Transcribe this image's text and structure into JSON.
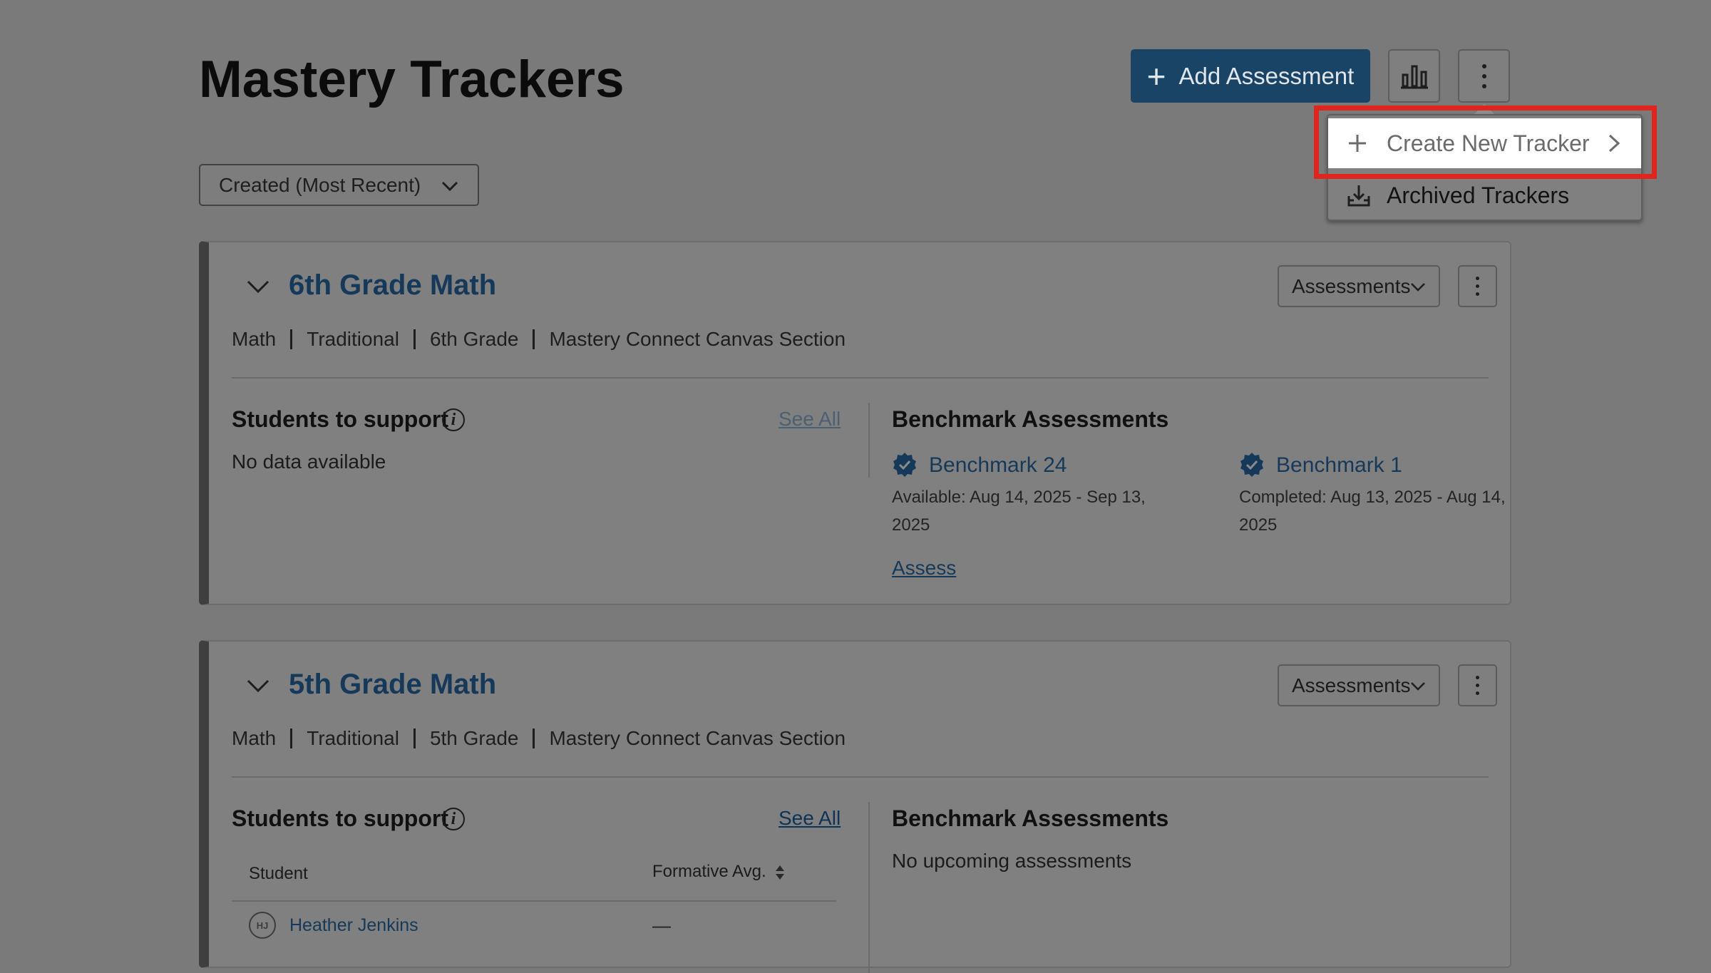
{
  "header": {
    "title": "Mastery Trackers",
    "add_assessment_label": "Add Assessment",
    "chart_icon": "bar-chart-icon",
    "more_icon": "kebab-icon"
  },
  "sort": {
    "selected": "Created (Most Recent)"
  },
  "menu": {
    "create_label": "Create New Tracker",
    "archived_label": "Archived Trackers"
  },
  "trackers": [
    {
      "title": "6th Grade Math",
      "assessments_label": "Assessments",
      "meta": [
        "Math",
        "Traditional",
        "6th Grade",
        "Mastery Connect Canvas Section"
      ],
      "students_title": "Students to support",
      "see_all": "See All",
      "students_empty": "No data available",
      "benchmark_title": "Benchmark Assessments",
      "benchmarks": [
        {
          "name": "Benchmark 24",
          "detail_line1": "Available: Aug 14, 2025 - Sep 13,",
          "detail_line2": "2025",
          "action": "Assess"
        },
        {
          "name": "Benchmark 1",
          "detail_line1": "Completed: Aug 13, 2025 - Aug 14,",
          "detail_line2": "2025"
        }
      ]
    },
    {
      "title": "5th Grade Math",
      "assessments_label": "Assessments",
      "meta": [
        "Math",
        "Traditional",
        "5th Grade",
        "Mastery Connect Canvas Section"
      ],
      "students_title": "Students to support",
      "see_all": "See All",
      "table_headers": [
        "Student",
        "Formative Avg."
      ],
      "students": [
        {
          "initials": "HJ",
          "name": "Heather Jenkins",
          "avg": "—"
        }
      ],
      "benchmark_title": "Benchmark Assessments",
      "benchmark_empty": "No upcoming assessments"
    }
  ],
  "colors": {
    "primary_button": "#1a4466",
    "link": "#16395a",
    "highlight": "#e0241e"
  }
}
